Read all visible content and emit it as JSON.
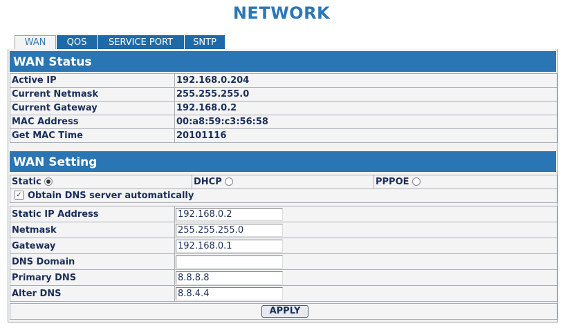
{
  "page": {
    "title": "NETWORK"
  },
  "tabs": [
    {
      "label": "WAN",
      "active": true
    },
    {
      "label": "QOS",
      "active": false
    },
    {
      "label": "SERVICE PORT",
      "active": false
    },
    {
      "label": "SNTP",
      "active": false
    }
  ],
  "wan_status": {
    "title": "WAN Status",
    "rows": [
      {
        "label": "Active IP",
        "value": "192.168.0.204"
      },
      {
        "label": "Current Netmask",
        "value": "255.255.255.0"
      },
      {
        "label": "Current Gateway",
        "value": "192.168.0.2"
      },
      {
        "label": "MAC Address",
        "value": "00:a8:59:c3:56:58"
      },
      {
        "label": "Get MAC Time",
        "value": "20101116"
      }
    ]
  },
  "wan_setting": {
    "title": "WAN Setting",
    "modes": [
      {
        "label": "Static",
        "selected": true
      },
      {
        "label": "DHCP",
        "selected": false
      },
      {
        "label": "PPPOE",
        "selected": false
      }
    ],
    "obtain_dns": {
      "label": "Obtain DNS server automatically",
      "checked": true
    },
    "fields": [
      {
        "label": "Static IP Address",
        "value": "192.168.0.2"
      },
      {
        "label": "Netmask",
        "value": "255.255.255.0"
      },
      {
        "label": "Gateway",
        "value": "192.168.0.1"
      },
      {
        "label": "DNS Domain",
        "value": ""
      },
      {
        "label": "Primary DNS",
        "value": "8.8.8.8"
      },
      {
        "label": "Alter DNS",
        "value": "8.8.4.4"
      }
    ]
  },
  "apply_label": "APPLY"
}
